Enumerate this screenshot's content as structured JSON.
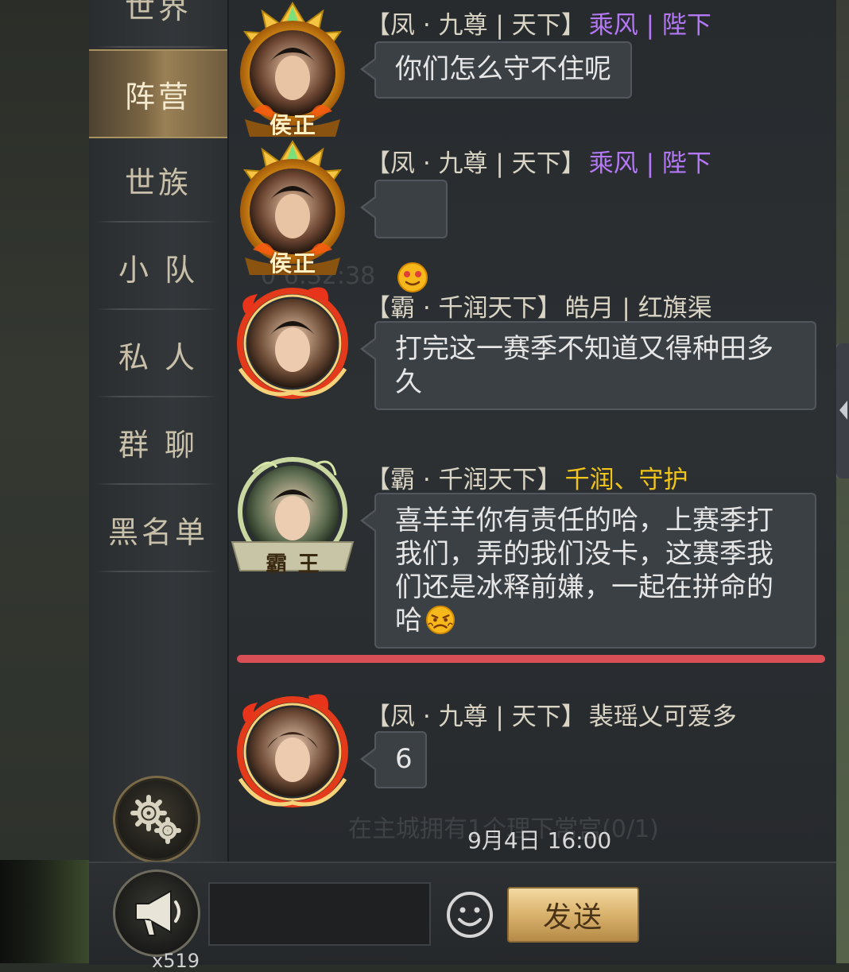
{
  "sidebar": {
    "tabs": [
      {
        "label": "世界"
      },
      {
        "label": "阵营"
      },
      {
        "label": "世族"
      },
      {
        "label": "小 队"
      },
      {
        "label": "私 人"
      },
      {
        "label": "群 聊"
      },
      {
        "label": "黑名单"
      }
    ],
    "active_tab": "阵营",
    "settings_icon": "gear-icon"
  },
  "background_text": {
    "line1": "0 6:32:38",
    "line2": "在主城拥有1个理下常宫(0/1)"
  },
  "messages": [
    {
      "title_badge": "侯正",
      "guild_tag": "【凤 · 九尊 | 天下】",
      "player": "乘风 | 陛下",
      "player_color": "#b477f5",
      "text": "你们怎么守不住呢"
    },
    {
      "title_badge": "侯正",
      "guild_tag": "【凤 · 九尊 | 天下】",
      "player": "乘风 | 陛下",
      "player_color": "#b477f5",
      "emoji": "smile-emoji"
    },
    {
      "guild_tag": "【霸 · 千润天下】",
      "player": "皓月 | 红旗渠",
      "player_color": "#d9d4c4",
      "text": "打完这一赛季不知道又得种田多\n久"
    },
    {
      "title_badge": "霸 王",
      "guild_tag": "【霸 · 千润天下】",
      "player": "千润、守护",
      "player_color": "#f0c419",
      "text": "喜羊羊你有责任的哈，上赛季打\n我们，弄的我们没卡，这赛季我\n们还是冰释前嫌，一起在拼命的\n哈",
      "emoji": "angry-emoji"
    },
    {
      "guild_tag": "【凤 · 九尊 | 天下】",
      "player": "裴瑶乂可爱多",
      "player_color": "#d9d4c4",
      "text": "6"
    }
  ],
  "timestamp": "9月4日 16:00",
  "bottom_bar": {
    "horn_icon": "megaphone-icon",
    "horn_count": "x519",
    "input_value": "",
    "emoji_icon": "smiley-face-icon",
    "send_label": "发送"
  },
  "colors": {
    "accent_gold": "#d9b26c",
    "divider_red": "#d84f55",
    "bubble_bg": "#3b4045"
  }
}
